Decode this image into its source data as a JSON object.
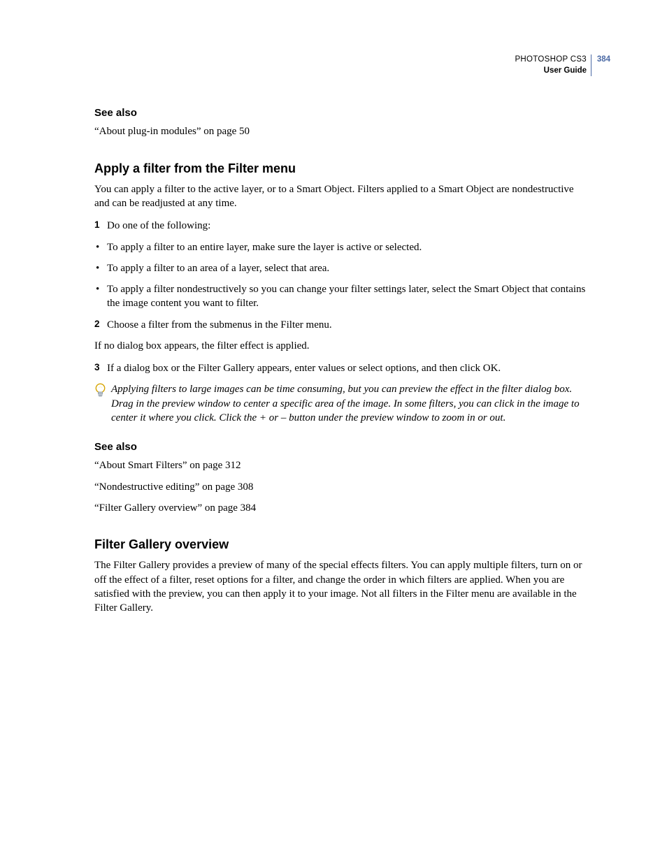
{
  "header": {
    "product": "PHOTOSHOP CS3",
    "docType": "User Guide",
    "pageNumber": "384"
  },
  "seeAlso1": {
    "heading": "See also",
    "items": [
      "“About plug-in modules” on page 50"
    ]
  },
  "section1": {
    "title": "Apply a filter from the Filter menu",
    "intro": "You can apply a filter to the active layer, or to a Smart Object. Filters applied to a Smart Object are nondestructive and can be readjusted at any time.",
    "step1": {
      "num": "1",
      "text": "Do one of the following:"
    },
    "bullets": [
      "To apply a filter to an entire layer, make sure the layer is active or selected.",
      "To apply a filter to an area of a layer, select that area.",
      "To apply a filter nondestructively so you can change your filter settings later, select the Smart Object that contains the image content you want to filter."
    ],
    "step2": {
      "num": "2",
      "text": "Choose a filter from the submenus in the Filter menu."
    },
    "note": "If no dialog box appears, the filter effect is applied.",
    "step3": {
      "num": "3",
      "text": "If a dialog box or the Filter Gallery appears, enter values or select options, and then click OK."
    },
    "tip": "Applying filters to large images can be time consuming, but you can preview the effect in the filter dialog box. Drag in the preview window to center a specific area of the image. In some filters, you can click in the image to center it where you click. Click the + or – button under the preview window to zoom in or out."
  },
  "seeAlso2": {
    "heading": "See also",
    "items": [
      "“About Smart Filters” on page 312",
      "“Nondestructive editing” on page 308",
      "“Filter Gallery overview” on page 384"
    ]
  },
  "section2": {
    "title": "Filter Gallery overview",
    "body": "The Filter Gallery provides a preview of many of the special effects filters. You can apply multiple filters, turn on or off the effect of a filter, reset options for a filter, and change the order in which filters are applied. When you are satisfied with the preview, you can then apply it to your image. Not all filters in the Filter menu are available in the Filter Gallery."
  }
}
